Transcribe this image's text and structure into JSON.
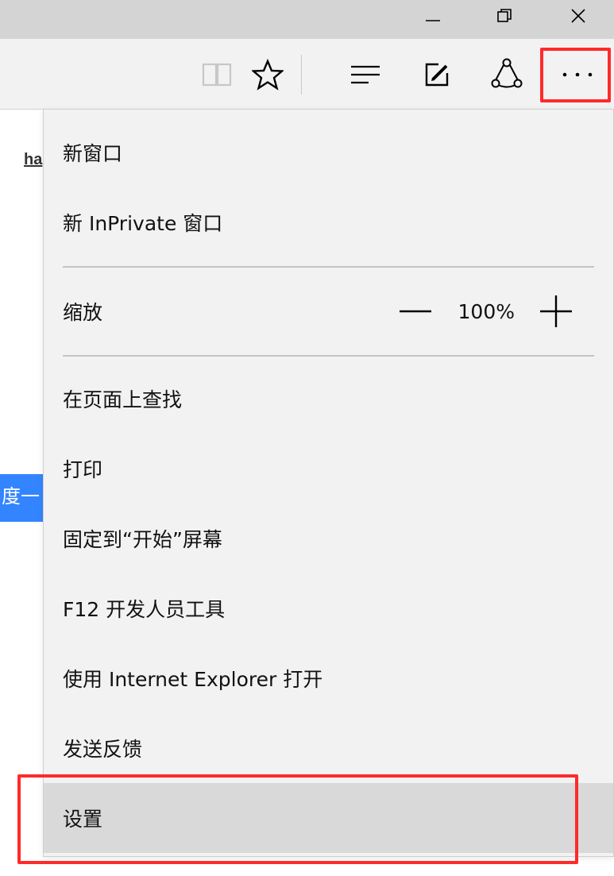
{
  "window": {
    "controls": [
      "minimize-icon",
      "restore-icon",
      "close-icon"
    ]
  },
  "toolbar": {
    "icons": [
      "reading-view-icon",
      "favorite-star-icon",
      "hub-icon",
      "web-note-icon",
      "share-icon",
      "more-icon"
    ]
  },
  "page": {
    "link_text": "ha",
    "button_text": "度一"
  },
  "menu": {
    "new_window": "新窗口",
    "new_inprivate": "新 InPrivate 窗口",
    "zoom_label": "缩放",
    "zoom_value": "100%",
    "find_on_page": "在页面上查找",
    "print": "打印",
    "pin_to_start": "固定到“开始”屏幕",
    "f12_tools": "F12 开发人员工具",
    "open_with_ie": "使用 Internet Explorer 打开",
    "send_feedback": "发送反馈",
    "settings": "设置"
  },
  "colors": {
    "highlight": "#ff2a2a",
    "page_button": "#3385ff",
    "menu_background": "#f2f2f2",
    "selected_item": "#d9d9d9"
  }
}
